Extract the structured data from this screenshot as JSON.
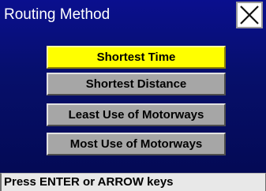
{
  "window": {
    "title": "Routing Method",
    "close_icon": "close-icon"
  },
  "options": [
    {
      "label": "Shortest Time",
      "selected": true
    },
    {
      "label": "Shortest Distance",
      "selected": false
    },
    {
      "label": "Least Use of Motorways",
      "selected": false
    },
    {
      "label": "Most Use of Motorways",
      "selected": false
    }
  ],
  "status": {
    "text": "Press ENTER or ARROW keys"
  },
  "colors": {
    "background": "#060f6a",
    "selected": "#ffff00",
    "unselected": "#a6a6a6"
  }
}
